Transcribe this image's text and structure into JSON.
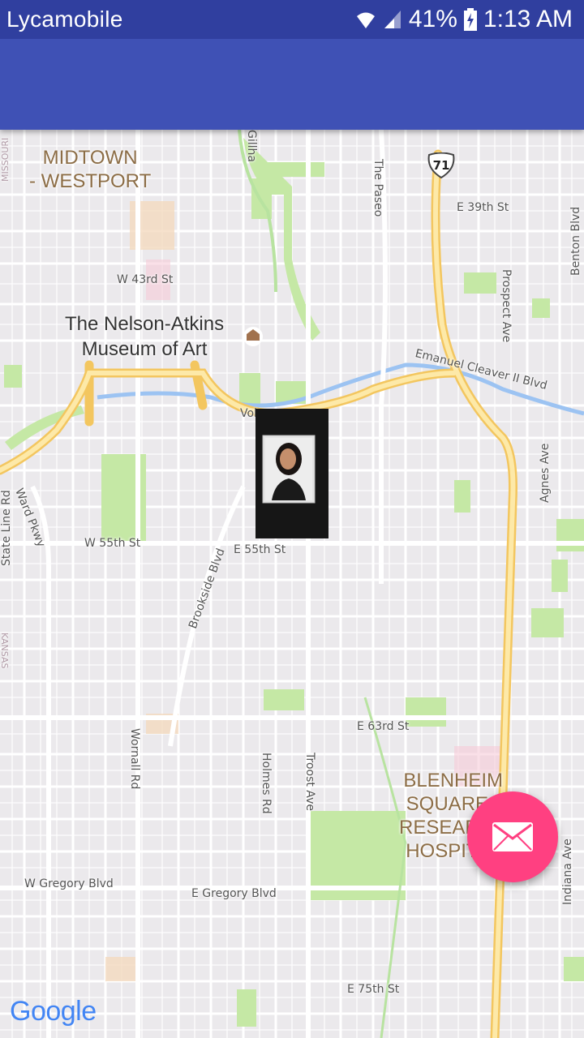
{
  "status_bar": {
    "carrier": "Lycamobile",
    "battery": "41%",
    "time": "1:13 AM"
  },
  "map": {
    "districts": [
      {
        "id": "midtown",
        "lines": [
          "MIDTOWN",
          "- WESTPORT"
        ]
      },
      {
        "id": "blenheim",
        "lines": [
          "BLENHEIM",
          "SQUARE -",
          "RESEARCH",
          "HOSPITAL"
        ]
      }
    ],
    "poi": {
      "lines": [
        "The Nelson-Atkins",
        "Museum of Art"
      ]
    },
    "streets": {
      "e39": "E 39th St",
      "w43": "W 43rd St",
      "paseo": "The Paseo",
      "prospect": "Prospect Ave",
      "benton": "Benton Blvd",
      "emanuel": "Emanuel Cleaver II Blvd",
      "agnes": "Agnes Ave",
      "w55": "W 55th St",
      "e55": "E 55th St",
      "brookside": "Brookside Blvd",
      "ward": "Ward Pkwy",
      "stateline": "State Line Rd",
      "e63": "E 63rd St",
      "wornall": "Wornall Rd",
      "holmes": "Holmes Rd",
      "troost": "Troost Ave",
      "wgregory": "W Gregory Blvd",
      "egregory": "E Gregory Blvd",
      "indiana": "Indiana Ave",
      "e75": "E 75th St",
      "gillham": "Gillha",
      "volker": "Vol",
      "missouri": "MISSOURI",
      "kansas": "KANSAS"
    },
    "highway_shield": "71",
    "attribution": "Google"
  },
  "colors": {
    "status_bar": "#303f9f",
    "toolbar": "#3f51b5",
    "fab": "#ff4081",
    "park": "#c5e8a5",
    "highway": "#f9d77a"
  }
}
